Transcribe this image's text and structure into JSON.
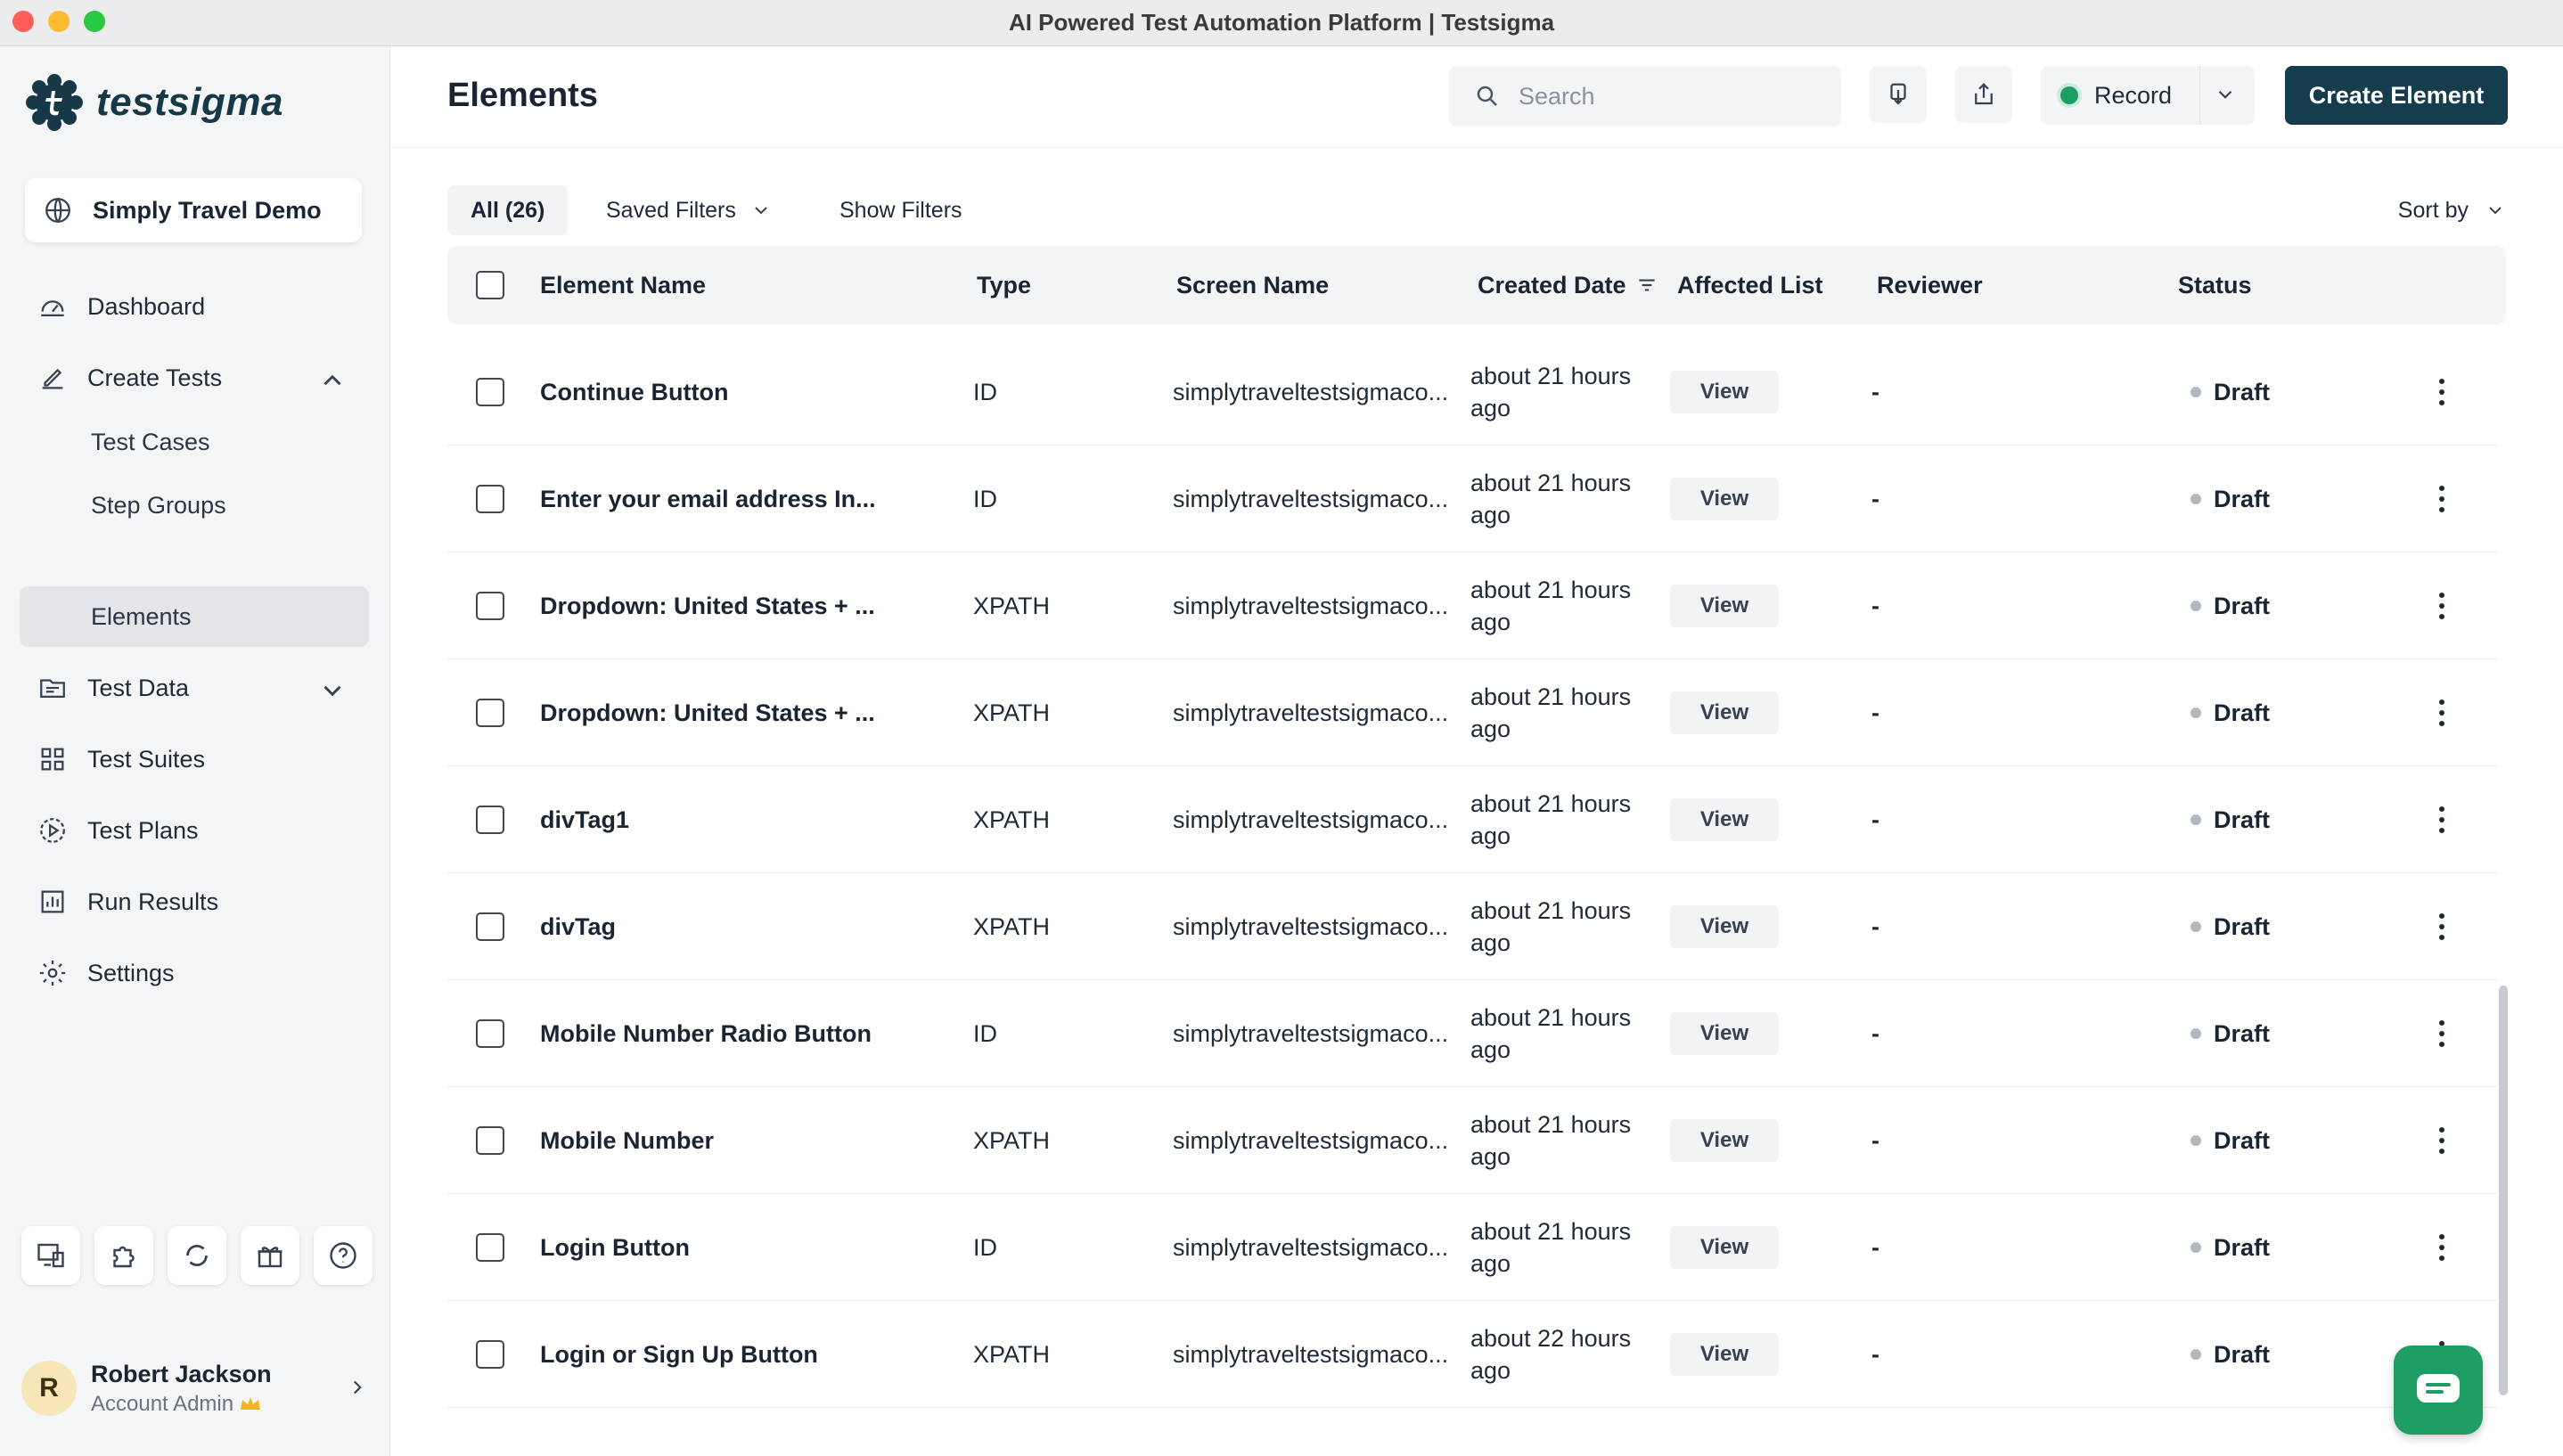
{
  "window": {
    "title": "AI Powered Test Automation Platform | Testsigma"
  },
  "brand": {
    "name": "testsigma",
    "color": "#163847",
    "accent": "#1e9e64"
  },
  "sidebar": {
    "project": "Simply Travel Demo",
    "nav": {
      "dashboard": "Dashboard",
      "create_tests": "Create Tests",
      "test_cases": "Test Cases",
      "step_groups": "Step Groups",
      "elements": "Elements",
      "test_data": "Test Data",
      "test_suites": "Test Suites",
      "test_plans": "Test Plans",
      "run_results": "Run Results",
      "settings": "Settings"
    },
    "bottom_icons": [
      "devices-icon",
      "puzzle-icon",
      "refresh-icon",
      "gift-icon",
      "help-icon"
    ],
    "user": {
      "initial": "R",
      "name": "Robert Jackson",
      "role": "Account Admin"
    }
  },
  "header": {
    "title": "Elements",
    "search_placeholder": "Search",
    "record_label": "Record",
    "create_label": "Create Element"
  },
  "filters": {
    "all": "All (26)",
    "saved": "Saved Filters",
    "show": "Show Filters",
    "sort": "Sort by"
  },
  "table": {
    "columns": {
      "name": "Element Name",
      "type": "Type",
      "screen": "Screen Name",
      "created": "Created Date",
      "affected": "Affected List",
      "reviewer": "Reviewer",
      "status": "Status"
    },
    "rows": [
      {
        "name": "Continue Button",
        "type": "ID",
        "screen": "simplytraveltestsigmaco...",
        "date1": "about 21 hours",
        "date2": "ago",
        "view": "View",
        "reviewer": "-",
        "status": "Draft"
      },
      {
        "name": "Enter your email address In...",
        "type": "ID",
        "screen": "simplytraveltestsigmaco...",
        "date1": "about 21 hours",
        "date2": "ago",
        "view": "View",
        "reviewer": "-",
        "status": "Draft"
      },
      {
        "name": "Dropdown: United States + ...",
        "type": "XPATH",
        "screen": "simplytraveltestsigmaco...",
        "date1": "about 21 hours",
        "date2": "ago",
        "view": "View",
        "reviewer": "-",
        "status": "Draft"
      },
      {
        "name": "Dropdown: United States + ...",
        "type": "XPATH",
        "screen": "simplytraveltestsigmaco...",
        "date1": "about 21 hours",
        "date2": "ago",
        "view": "View",
        "reviewer": "-",
        "status": "Draft"
      },
      {
        "name": "divTag1",
        "type": "XPATH",
        "screen": "simplytraveltestsigmaco...",
        "date1": "about 21 hours",
        "date2": "ago",
        "view": "View",
        "reviewer": "-",
        "status": "Draft"
      },
      {
        "name": "divTag",
        "type": "XPATH",
        "screen": "simplytraveltestsigmaco...",
        "date1": "about 21 hours",
        "date2": "ago",
        "view": "View",
        "reviewer": "-",
        "status": "Draft"
      },
      {
        "name": "Mobile Number Radio Button",
        "type": "ID",
        "screen": "simplytraveltestsigmaco...",
        "date1": "about 21 hours",
        "date2": "ago",
        "view": "View",
        "reviewer": "-",
        "status": "Draft"
      },
      {
        "name": "Mobile Number",
        "type": "XPATH",
        "screen": "simplytraveltestsigmaco...",
        "date1": "about 21 hours",
        "date2": "ago",
        "view": "View",
        "reviewer": "-",
        "status": "Draft"
      },
      {
        "name": "Login Button",
        "type": "ID",
        "screen": "simplytraveltestsigmaco...",
        "date1": "about 21 hours",
        "date2": "ago",
        "view": "View",
        "reviewer": "-",
        "status": "Draft"
      },
      {
        "name": "Login or Sign Up Button",
        "type": "XPATH",
        "screen": "simplytraveltestsigmaco...",
        "date1": "about 22 hours",
        "date2": "ago",
        "view": "View",
        "reviewer": "-",
        "status": "Draft"
      }
    ]
  }
}
